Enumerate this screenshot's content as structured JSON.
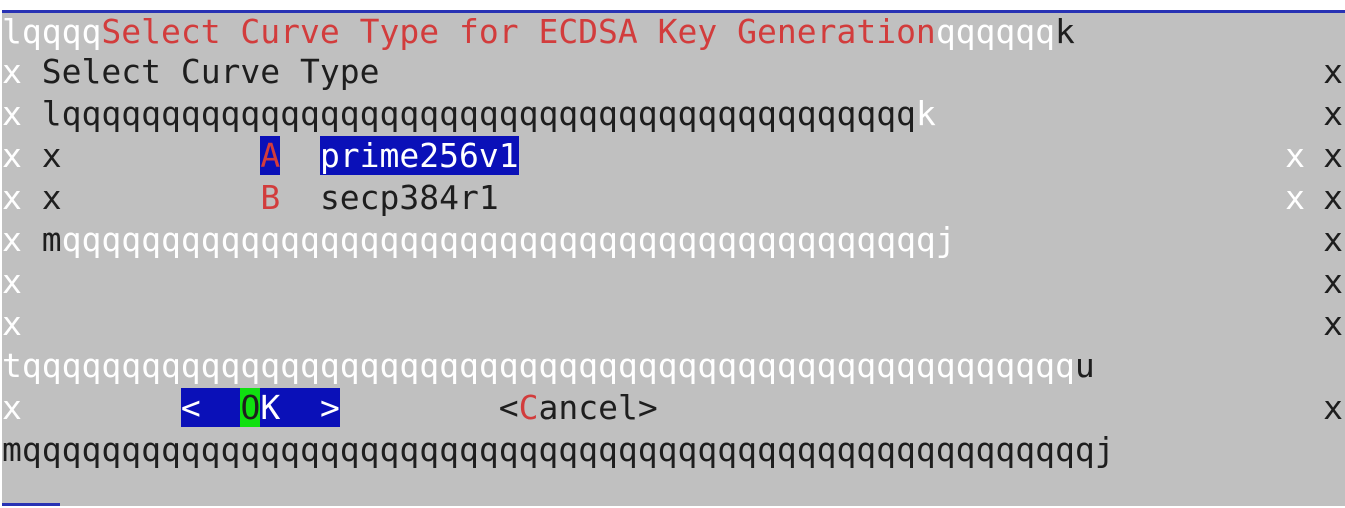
{
  "dialog": {
    "title": "Select Curve Type for ECDSA Key Generation",
    "prompt": "Select Curve Type"
  },
  "menu": {
    "items": [
      {
        "tag": "A",
        "label": "prime256v1",
        "selected": true
      },
      {
        "tag": "B",
        "label": "secp384r1",
        "selected": false
      }
    ]
  },
  "buttons": {
    "ok": {
      "lt": "<",
      "hot": "O",
      "rest": "K",
      "gt": ">"
    },
    "cancel": {
      "lt": "<",
      "hot": "C",
      "rest": "ancel",
      "gt": ">"
    }
  },
  "box_chars": {
    "top_left": "l",
    "top_right": "k",
    "hline_top_left": "qqqq",
    "hline_top_right": "qqqqqq",
    "vline": "x",
    "inner_top": "lqqqqqqqqqqqqqqqqqqqqqqqqqqqqqqqqqqqqqqqqqqq",
    "inner_top_end": "k",
    "inner_bottom_start": "m",
    "inner_bottom": "qqqqqqqqqqqqqqqqqqqqqqqqqqqqqqqqqqqqqqqqqqqqj",
    "separator": "tqqqqqqqqqqqqqqqqqqqqqqqqqqqqqqqqqqqqqqqqqqqqqqqqqqqqq",
    "separator_end": "u",
    "bottom": "mqqqqqqqqqqqqqqqqqqqqqqqqqqqqqqqqqqqqqqqqqqqqqqqqqqqqqqj"
  },
  "colors": {
    "background": "#c0c0c0",
    "selection": "#0a10b8",
    "title": "#d23c3c",
    "hotkey": "#d23c3c",
    "focus_highlight": "#10e010"
  }
}
